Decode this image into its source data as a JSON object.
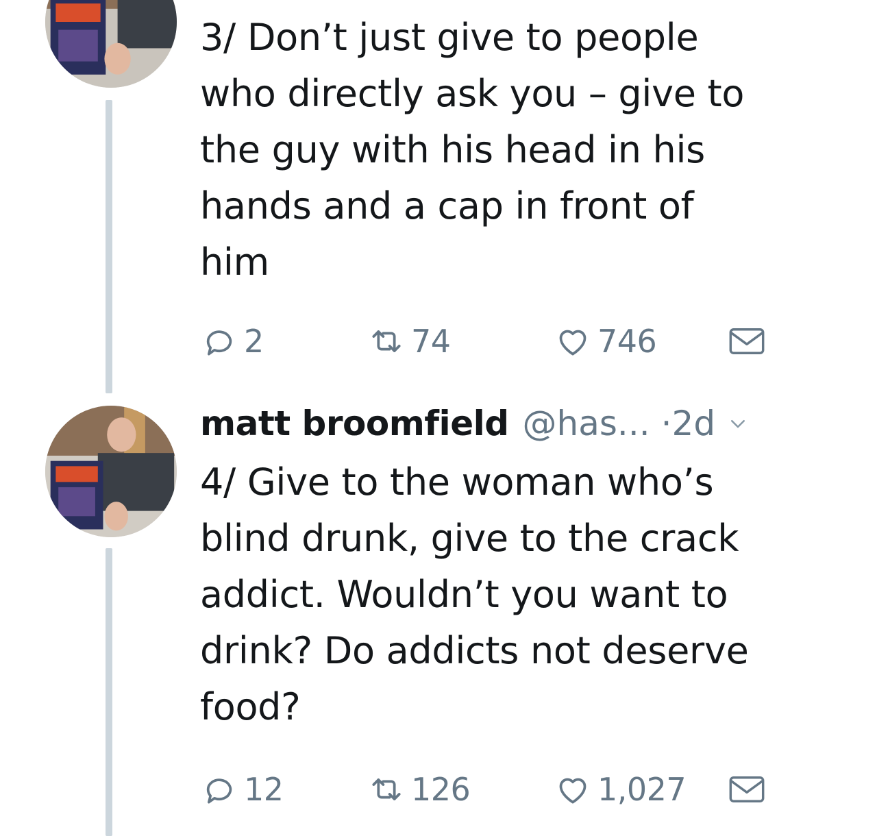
{
  "tweets": [
    {
      "text": "3/ Don’t just give to people\nwho directly ask you – give to\nthe guy with his head in his\nhands and a cap in front of\nhim",
      "actions": {
        "replies": "2",
        "retweets": "74",
        "likes": "746"
      }
    },
    {
      "author": "matt broomfield",
      "handle": "@has...",
      "time": "·2d",
      "text": "4/ Give to the woman who’s\nblind drunk, give to the crack\naddict. Wouldn’t you want to\ndrink? Do addicts not deserve\nfood?",
      "actions": {
        "replies": "12",
        "retweets": "126",
        "likes": "1,027"
      }
    }
  ],
  "colors": {
    "text": "#14171a",
    "secondary": "#657786",
    "thread_line": "#ccd6dd"
  },
  "icons": [
    "reply-icon",
    "retweet-icon",
    "like-icon",
    "direct-message-icon",
    "chevron-down-icon"
  ]
}
